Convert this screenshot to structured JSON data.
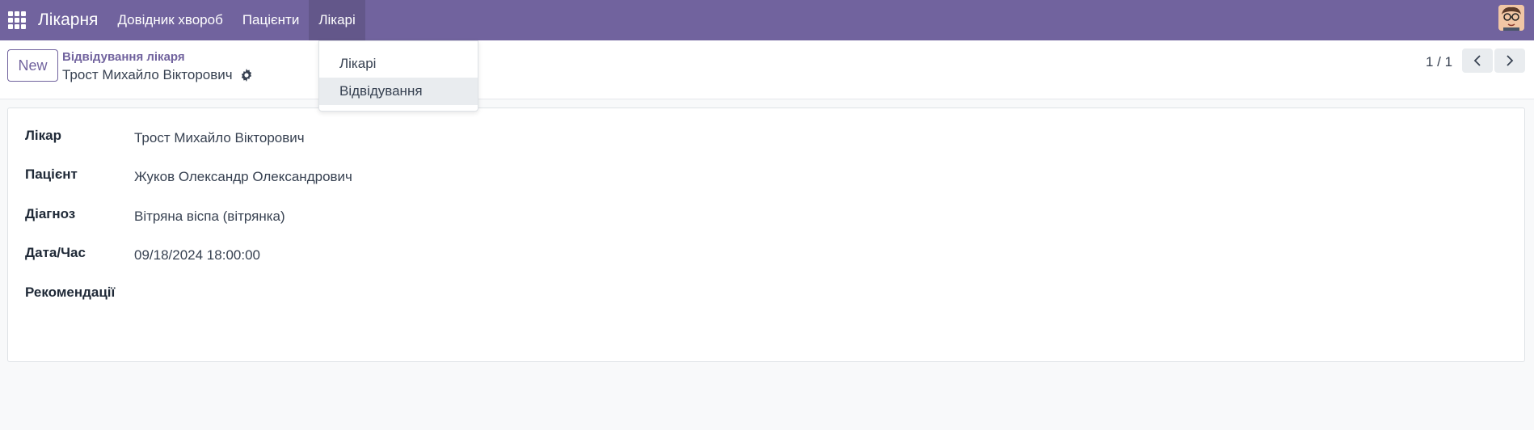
{
  "navbar": {
    "brand": "Лікарня",
    "items": [
      {
        "label": "Довідник хвороб"
      },
      {
        "label": "Пацієнти"
      },
      {
        "label": "Лікарі"
      }
    ]
  },
  "dropdown": {
    "items": [
      {
        "label": "Лікарі"
      },
      {
        "label": "Відвідування"
      }
    ]
  },
  "control_panel": {
    "new_label": "New",
    "breadcrumb_parent": "Відвідування лікаря",
    "breadcrumb_current": "Трост Михайло Вікторович",
    "pager": "1 / 1"
  },
  "form": {
    "fields": [
      {
        "label": "Лікар",
        "value": "Трост Михайло Вікторович"
      },
      {
        "label": "Пацієнт",
        "value": "Жуков Олександр Олександрович"
      },
      {
        "label": "Діагноз",
        "value": "Вітряна віспа (вітрянка)"
      },
      {
        "label": "Дата/Час",
        "value": "09/18/2024 18:00:00"
      },
      {
        "label": "Рекомендації",
        "value": ""
      }
    ]
  },
  "colors": {
    "brand": "#71639e",
    "background": "#f8f9fa"
  },
  "icons": [
    "apps-grid-icon",
    "gear-icon",
    "chevron-left-icon",
    "chevron-right-icon",
    "avatar"
  ]
}
